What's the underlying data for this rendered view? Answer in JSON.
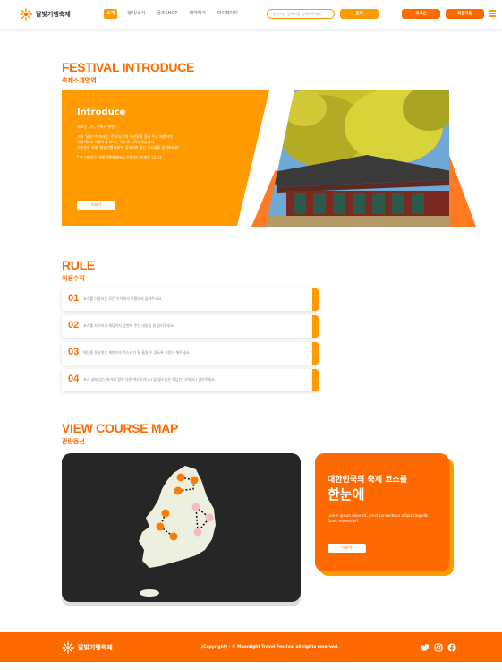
{
  "header": {
    "logo_text": "달빛기행축제",
    "nav": [
      "소개",
      "행사/소식",
      "굿즈SHOP",
      "예약하기",
      "마이페이지"
    ],
    "search_placeholder": "원하시는 검색어를 입력해주세요",
    "search_label": "검색",
    "login_label": "로그인",
    "signup_label": "회원가입"
  },
  "intro": {
    "title": "FESTIVAL INTRODUCE",
    "subtitle": "축제소개영역",
    "heading": "Introduce",
    "lines_1": [
      "새로운 시작, 문화의 향연"
    ],
    "lines_2": [
      "저희 '달빛기행축제'는 전국의 문화 유산들을 알려 주고 체험하여",
      "재밌어보고 이행하게 보이는 의도로 기획되었습니다.",
      "여러분도 저희 '달빛기행축제'에 참여하여 좋은 명소들을 즐겨보세요!"
    ],
    "lines_3": [
      "* 본 이벤트는 달빛기행축제에서 진행하는 이벤트 입니다."
    ],
    "more_label": "더보기"
  },
  "rule": {
    "title": "RULE",
    "subtitle": "이용수칙",
    "items": [
      {
        "num": "01",
        "text": "코스를 이용하는 모든 이이에서 이탈하지 않아주세요."
      },
      {
        "num": "02",
        "text": "코스를 사이하고 해당가지 앉변에 주는 내용을 잘 읽어주세요."
      },
      {
        "num": "03",
        "text": "해당을 못달력는 제한가의 목소리가 잘 들릴 수 있도록 조용히 해주세요."
      },
      {
        "num": "04",
        "text": "코스 내에 있는 여가의 함께 다른 여가이기(스) 및 명소등은 해답(는 가지(도) 않아주세요."
      }
    ]
  },
  "course": {
    "title": "VIEW COURSE MAP",
    "subtitle": "관람동선",
    "card_title": "대한민국의 축제 코스를",
    "card_big": "한눈에",
    "card_desc": "Lorem ipsum dolor sit, amet consectetur adipisicing elit. Quos, molestiae?",
    "more_label": "더보기"
  },
  "footer": {
    "logo_text": "달빛기행축제",
    "copyright": "(Copyright) - © Moonlight Travel Festival all rights reserved."
  },
  "colors": {
    "accent": "#ff6a00",
    "accent_light": "#ff9a00",
    "map_bg": "#262626"
  }
}
